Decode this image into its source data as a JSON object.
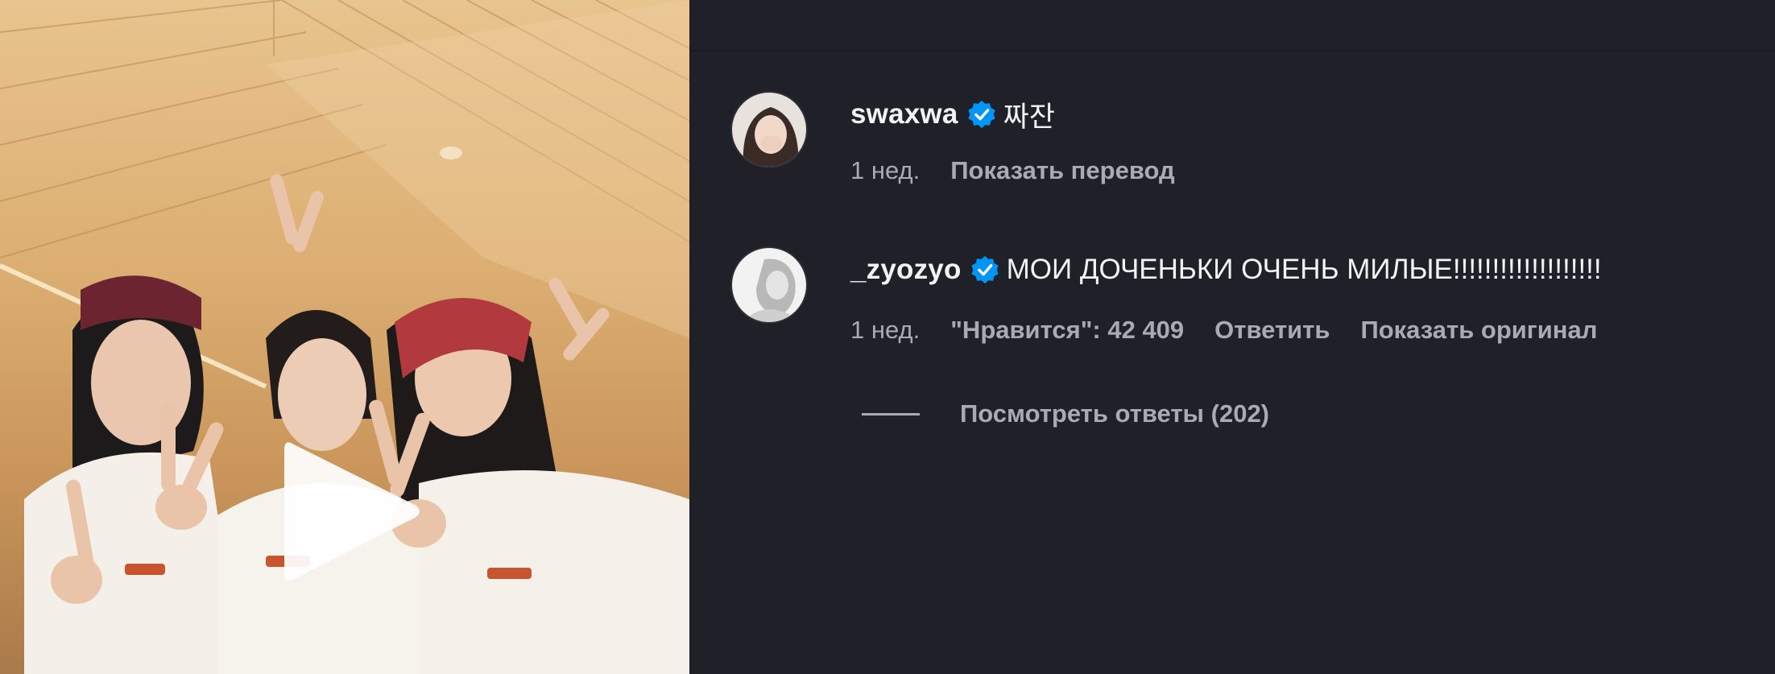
{
  "media": {
    "type": "video",
    "play_icon": "play-icon"
  },
  "comments": [
    {
      "username": "swaxwa",
      "verified": true,
      "text": "짜잔",
      "time": "1 нед.",
      "actions": [
        "Показать перевод"
      ]
    },
    {
      "username": "_zyozyo",
      "verified": true,
      "text": "МОИ ДОЧЕНЬКИ ОЧЕНЬ МИЛЫЕ!!!!!!!!!!!!!!!!!!!",
      "time": "1 нед.",
      "likes": "\"Нравится\": 42 409",
      "actions": [
        "Ответить",
        "Показать оригинал"
      ],
      "replies_label": "Посмотреть ответы (202)"
    }
  ],
  "colors": {
    "background": "#202128",
    "primary_text": "#f2f3f5",
    "secondary_text": "#a8abb3",
    "verified_badge": "#0095f6"
  }
}
